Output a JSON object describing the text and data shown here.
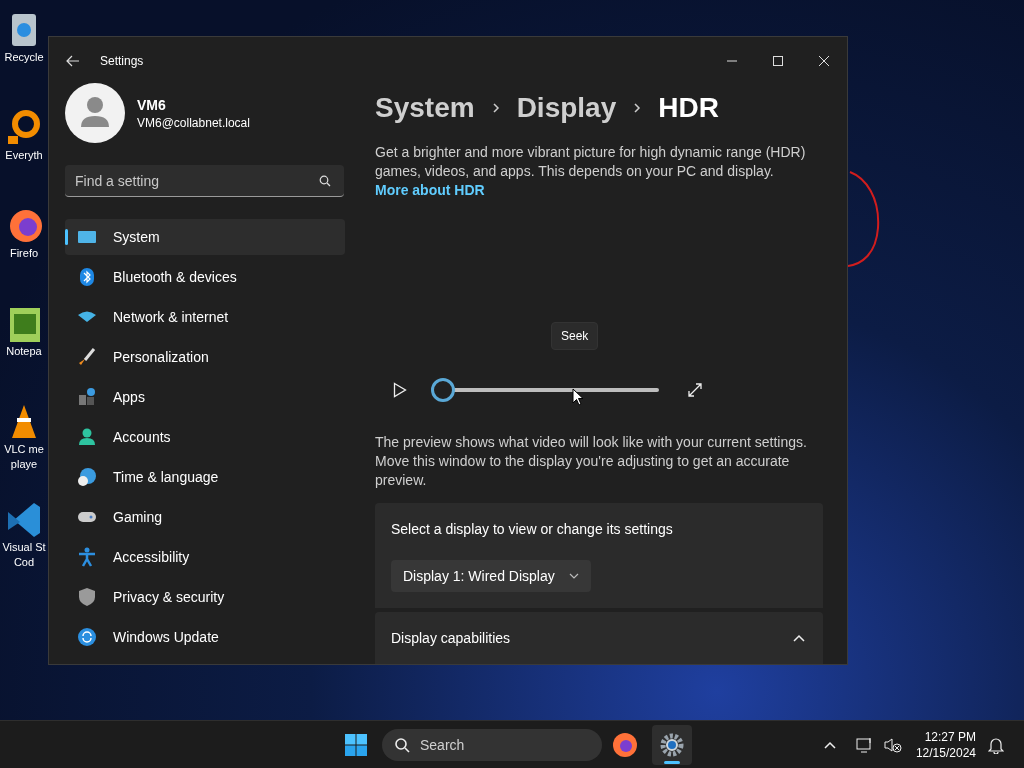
{
  "desktop_icons": [
    {
      "lines": [
        "Recycle"
      ]
    },
    {
      "lines": [
        "Everyth"
      ]
    },
    {
      "lines": [
        "Firefo"
      ]
    },
    {
      "lines": [
        "Notepa"
      ]
    },
    {
      "lines": [
        "VLC me",
        "playe"
      ]
    },
    {
      "lines": [
        "Visual St",
        "Cod"
      ]
    }
  ],
  "window": {
    "title": "Settings"
  },
  "user": {
    "name": "VM6",
    "email": "VM6@collabnet.local"
  },
  "search": {
    "placeholder": "Find a setting"
  },
  "sidebar": {
    "items": [
      {
        "label": "System",
        "selected": true
      },
      {
        "label": "Bluetooth & devices",
        "selected": false
      },
      {
        "label": "Network & internet",
        "selected": false
      },
      {
        "label": "Personalization",
        "selected": false
      },
      {
        "label": "Apps",
        "selected": false
      },
      {
        "label": "Accounts",
        "selected": false
      },
      {
        "label": "Time & language",
        "selected": false
      },
      {
        "label": "Gaming",
        "selected": false
      },
      {
        "label": "Accessibility",
        "selected": false
      },
      {
        "label": "Privacy & security",
        "selected": false
      },
      {
        "label": "Windows Update",
        "selected": false
      }
    ]
  },
  "breadcrumb": [
    "System",
    "Display",
    "HDR"
  ],
  "description": "Get a brighter and more vibrant picture for high dynamic range (HDR) games, videos, and apps. This depends on your PC and display.",
  "more_link": "More about HDR",
  "player": {
    "tooltip": "Seek",
    "level": 0
  },
  "preview_note": "The preview shows what video will look like with your current settings. Move this window to the display you're adjusting to get an accurate preview.",
  "display_select": {
    "label": "Select a display to view or change its settings",
    "value": "Display 1: Wired Display"
  },
  "capabilities": {
    "label": "Display capabilities",
    "expanded": true
  },
  "taskbar": {
    "search_placeholder": "Search",
    "time": "12:27 PM",
    "date": "12/15/2024"
  }
}
